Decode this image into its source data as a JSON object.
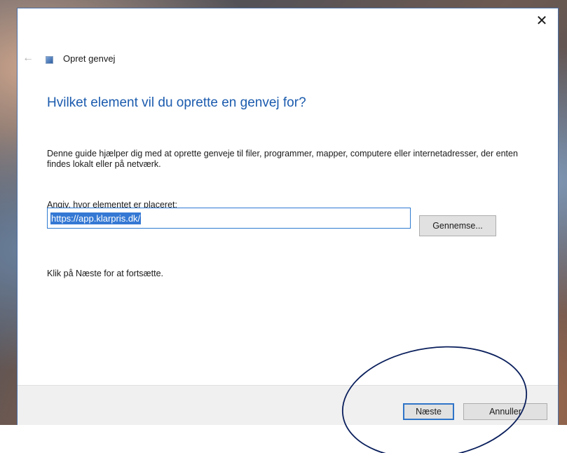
{
  "dialog": {
    "close_glyph": "✕",
    "back_glyph": "←",
    "title": "Opret genvej",
    "heading": "Hvilket element vil du oprette en genvej for?",
    "description": "Denne guide hjælper dig med at oprette genveje til filer, programmer, mapper, computere eller internetadresser, der enten findes lokalt eller på netværk.",
    "location_label": "Angiv, hvor elementet er placeret:",
    "location_value": "https://app.klarpris.dk/",
    "browse_label": "Gennemse...",
    "continue_text": "Klik på Næste for at fortsætte.",
    "next_label": "Næste",
    "cancel_label": "Annuller"
  },
  "icons": {
    "close": "close-icon",
    "back": "back-arrow-icon",
    "wizard": "shortcut-icon"
  },
  "colors": {
    "heading": "#1b5bae",
    "selection": "#3478d4",
    "input_border": "#2e7ad1",
    "annotation": "#0a1f5c"
  }
}
